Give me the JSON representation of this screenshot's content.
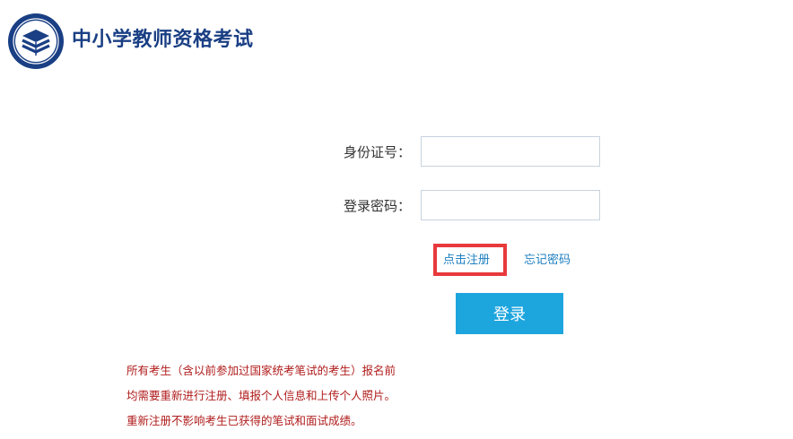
{
  "header": {
    "site_title": "中小学教师资格考试",
    "logo_icon": "teacher-qualification-seal-logo"
  },
  "form": {
    "id_label": "身份证号：",
    "id_value": "",
    "password_label": "登录密码：",
    "password_value": "",
    "register_link": "点击注册",
    "forgot_link": "忘记密码",
    "login_button": "登录"
  },
  "notice": {
    "lines": [
      "所有考生（含以前参加过国家统考笔试的考生）报名前",
      "均需要重新进行注册、填报个人信息和上传个人照片。",
      "重新注册不影响考生已获得的笔试和面试成绩。"
    ]
  },
  "colors": {
    "brand": "#1a3f84",
    "button": "#1da5de",
    "link": "#1e7fc1",
    "notice_text": "#b01b1b",
    "highlight_border": "#e8393c"
  }
}
